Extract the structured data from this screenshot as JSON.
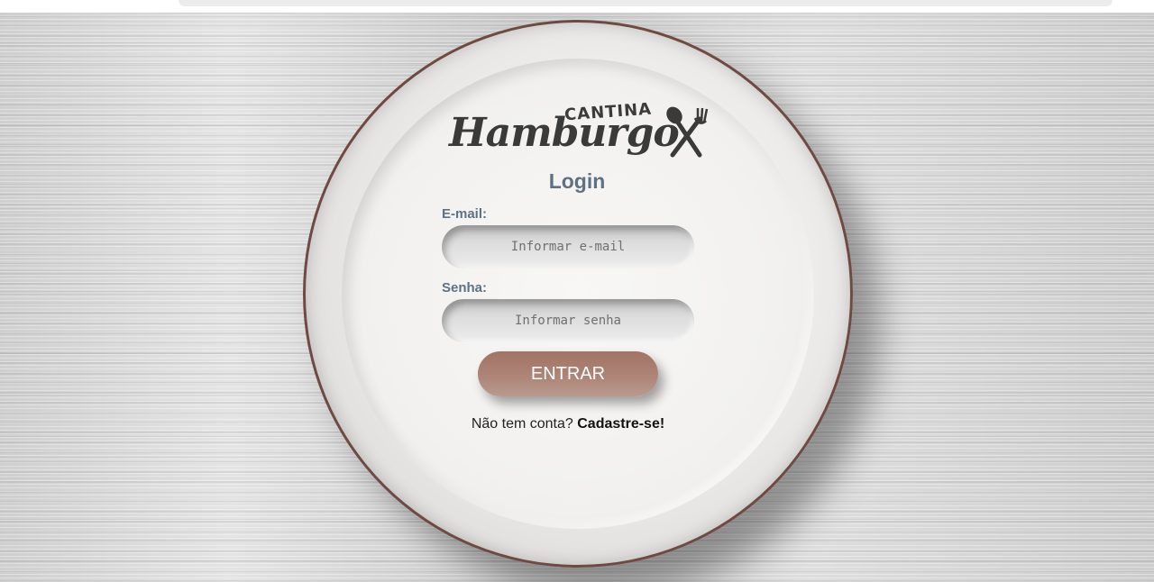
{
  "logo": {
    "top_word": "CANTINA",
    "main_word": "Hamburgo",
    "icon": "spoon-fork-icon"
  },
  "login": {
    "title": "Login",
    "email_label": "E-mail:",
    "email_placeholder": "Informar e-mail",
    "email_value": "",
    "password_label": "Senha:",
    "password_placeholder": "Informar senha",
    "password_value": "",
    "submit_label": "ENTRAR",
    "signup_prompt": "Não tem conta?",
    "signup_link": "Cadastre-se!"
  },
  "colors": {
    "label": "#5e7283",
    "button": "#a8796a",
    "plate_rim": "#6e4a42",
    "logo": "#3a3a3a"
  }
}
